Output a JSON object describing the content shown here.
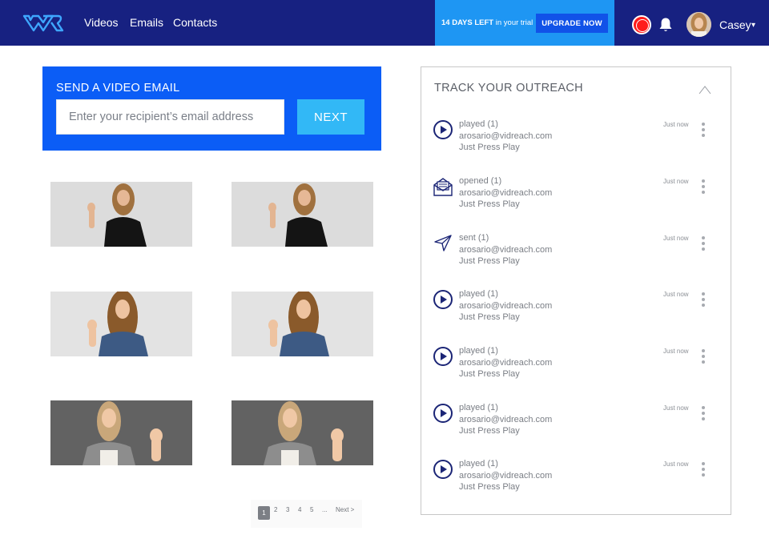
{
  "nav": {
    "links": [
      "Videos",
      "Emails",
      "Contacts"
    ],
    "trial_days": "14 DAYS LEFT",
    "trial_suffix": " in your trial",
    "upgrade_label": "UPGRADE NOW",
    "username": "Casey",
    "caret": "▾"
  },
  "send": {
    "title": "SEND A VIDEO EMAIL",
    "placeholder": "Enter your recipient’s email address",
    "next_label": "NEXT"
  },
  "pagination": {
    "active": "1",
    "pages": [
      "2",
      "3",
      "4",
      "5",
      "..."
    ],
    "next_label": "Next >"
  },
  "panel": {
    "title": "TRACK YOUR OUTREACH",
    "items": [
      {
        "icon": "play-circle-icon",
        "status": "played (1)",
        "email": "arosario@vidreach.com",
        "name": "Just Press Play",
        "time": "Just now"
      },
      {
        "icon": "envelope-open-icon",
        "status": "opened (1)",
        "email": "arosario@vidreach.com",
        "name": "Just Press Play",
        "time": "Just now"
      },
      {
        "icon": "paper-plane-icon",
        "status": "sent (1)",
        "email": "arosario@vidreach.com",
        "name": "Just Press Play",
        "time": "Just now"
      },
      {
        "icon": "play-circle-icon",
        "status": "played (1)",
        "email": "arosario@vidreach.com",
        "name": "Just Press Play",
        "time": "Just now"
      },
      {
        "icon": "play-circle-icon",
        "status": "played (1)",
        "email": "arosario@vidreach.com",
        "name": "Just Press Play",
        "time": "Just now"
      },
      {
        "icon": "play-circle-icon",
        "status": "played (1)",
        "email": "arosario@vidreach.com",
        "name": "Just Press Play",
        "time": "Just now"
      },
      {
        "icon": "play-circle-icon",
        "status": "played (1)",
        "email": "arosario@vidreach.com",
        "name": "Just Press Play",
        "time": "Just now"
      }
    ]
  },
  "colors": {
    "nav_bg": "#172181",
    "trial_bg": "#1e96f3",
    "upgrade_bg": "#1152e8",
    "send_bg": "#0b5df6",
    "next_bg": "#32b8f6",
    "record": "#ff1c1c",
    "icon_navy": "#1b2576"
  }
}
